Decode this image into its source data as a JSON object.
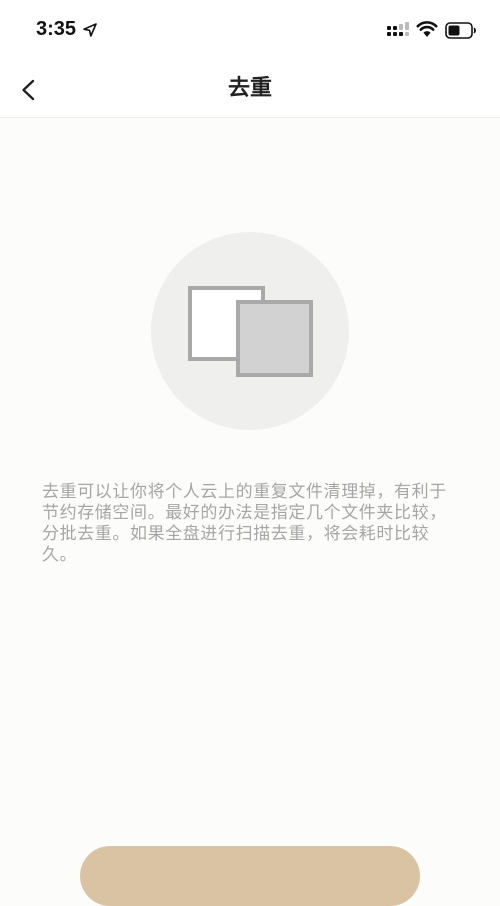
{
  "status_bar": {
    "time": "3:35",
    "icons": [
      "location-arrow-icon",
      "cellular-signal-icon",
      "wifi-icon",
      "battery-icon"
    ]
  },
  "nav": {
    "back_icon": "chevron-left-icon",
    "title": "去重"
  },
  "main": {
    "illustration_icon": "duplicate-files-icon",
    "description": "去重可以让你将个人云上的重复文件清理掉，有利于节约存储空间。最好的办法是指定几个文件夹比较，分批去重。如果全盘进行扫描去重，将会耗时比较久。"
  },
  "bottom": {
    "button_color": "#d9c3a3"
  },
  "colors": {
    "background": "#fcfcfa",
    "text_secondary": "#a6a6a6",
    "title": "#222222"
  }
}
